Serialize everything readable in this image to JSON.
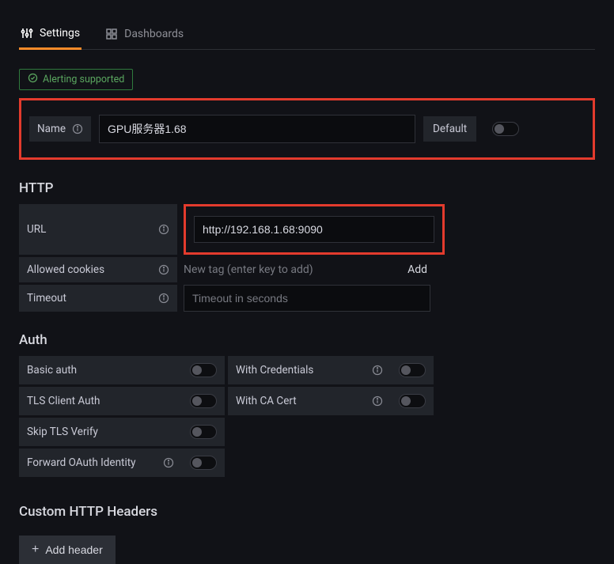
{
  "tabs": {
    "settings": "Settings",
    "dashboards": "Dashboards"
  },
  "alert_chip": "Alerting supported",
  "name": {
    "label": "Name",
    "value": "GPU服务器1.68",
    "default_label": "Default"
  },
  "http": {
    "title": "HTTP",
    "url_label": "URL",
    "url_value": "http://192.168.1.68:9090",
    "cookies_label": "Allowed cookies",
    "cookies_placeholder": "New tag (enter key to add)",
    "cookies_add": "Add",
    "timeout_label": "Timeout",
    "timeout_placeholder": "Timeout in seconds"
  },
  "auth": {
    "title": "Auth",
    "basic": "Basic auth",
    "with_credentials": "With Credentials",
    "tls_client": "TLS Client Auth",
    "with_ca": "With CA Cert",
    "skip_tls": "Skip TLS Verify",
    "forward_oauth": "Forward OAuth Identity"
  },
  "custom_headers": {
    "title": "Custom HTTP Headers",
    "add_button": "Add header"
  }
}
